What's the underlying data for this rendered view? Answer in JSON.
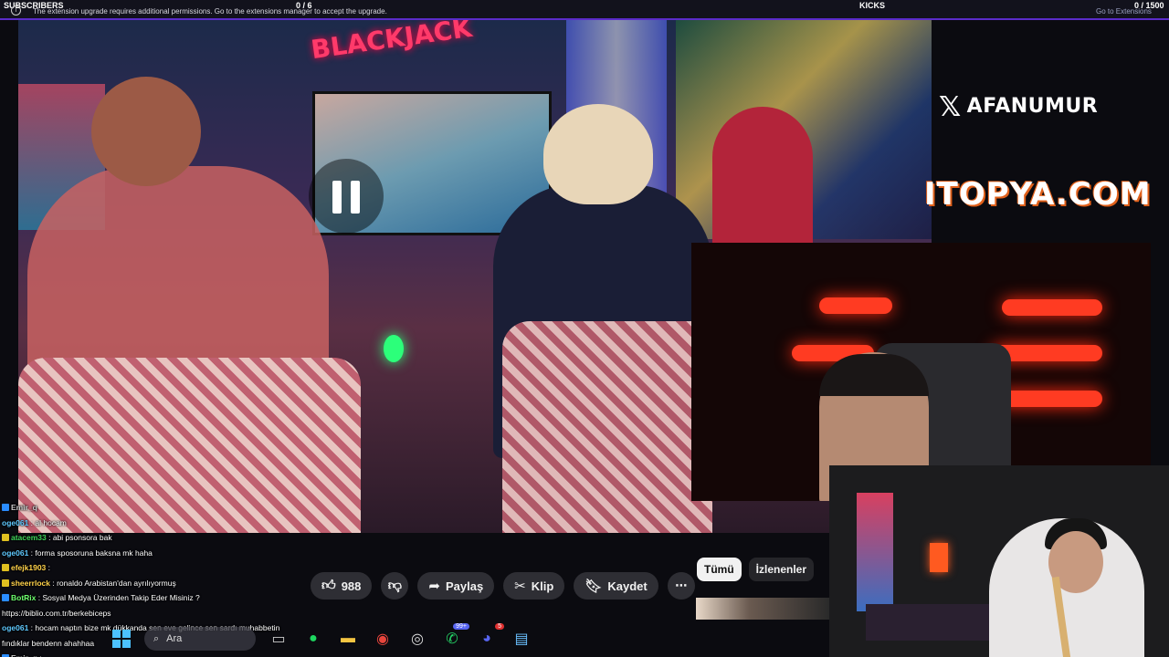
{
  "topbar": {
    "subscribers_label": "SUBSCRIBERS",
    "subscribers_count": "0 / 6",
    "extension_message": "The extension upgrade requires additional permissions. Go to the extensions manager to accept the upgrade.",
    "kicks_label": "KICKS",
    "kicks_count": "0 / 1500",
    "extension_link": "Go to Extensions"
  },
  "video": {
    "sign_text": "BLACKJACK",
    "handle": "AFANUMUR",
    "sponsor": "ITOPYA.COM"
  },
  "actions": {
    "like_count": "988",
    "share_label": "Paylaş",
    "clip_label": "Klip",
    "save_label": "Kaydet",
    "more_label": "⋯"
  },
  "filters": {
    "all": "Tümü",
    "watched": "İzlenenler"
  },
  "chat": [
    {
      "user": "Emir_q",
      "text": "",
      "color": "#c8c8c8",
      "badge": "#2a8cff"
    },
    {
      "user": "oge061",
      "text": ": al hocam",
      "color": "#5fc9ff",
      "badge": ""
    },
    {
      "user": "atacem33",
      "text": ": abi psonsora bak",
      "color": "#3fd45a",
      "badge": "#e0c020"
    },
    {
      "user": "oge061",
      "text": ": forma sposoruna baksna mk haha",
      "color": "#5fc9ff",
      "badge": ""
    },
    {
      "user": "efejk1903",
      "text": ":",
      "color": "#ffd24a",
      "badge": "#e0c020"
    },
    {
      "user": "sheerrlock",
      "text": ": ronaldo Arabistan'dan ayrılıyormuş",
      "color": "#ffd24a",
      "badge": "#e0c020"
    },
    {
      "user": "BotRix",
      "text": ": Sosyal Medya Üzerinden Takip Eder Misiniz ?",
      "color": "#6fff6f",
      "badge": "#2a8cff"
    },
    {
      "user": "",
      "text": "https://biblio.com.tr/berkebiceps",
      "color": "#ffffff",
      "badge": ""
    },
    {
      "user": "oge061",
      "text": ": hocam naptın bize mk dükkanda sen eve gelince sen sardı muhabbetin",
      "color": "#5fc9ff",
      "badge": ""
    },
    {
      "user": "",
      "text": "fındıklar bendenn ahahhaa",
      "color": "#ffffff",
      "badge": ""
    },
    {
      "user": "Emir_q",
      "text": ":",
      "color": "#c8c8c8",
      "badge": "#2a8cff"
    }
  ],
  "taskbar": {
    "search_placeholder": "Ara",
    "whatsapp_badge": "99+",
    "discord_badge": "5"
  },
  "colors": {
    "accent": "#5b2cc9",
    "sponsor_outline": "#e0601a"
  }
}
